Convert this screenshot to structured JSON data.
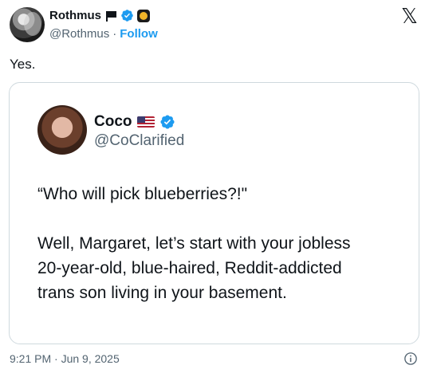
{
  "author": {
    "display_name": "Rothmus",
    "handle": "@Rothmus",
    "separator": "·",
    "follow_label": "Follow",
    "icons": [
      "flag-icon",
      "verified-icon",
      "badge-icon"
    ]
  },
  "brand": {
    "logo_text": "𝕏",
    "logo_name": "x-logo"
  },
  "tweet": {
    "text": "Yes."
  },
  "quoted": {
    "display_name": "Coco",
    "handle": "@CoClarified",
    "icons": [
      "us-flag-icon",
      "verified-icon"
    ],
    "lines": [
      "“Who will pick blueberries?!\"",
      "Well, Margaret, let’s start with your jobless",
      "20-year-old, blue-haired, Reddit-addicted",
      "trans son living in your basement."
    ]
  },
  "footer": {
    "timestamp": "9:21 PM · Jun 9, 2025",
    "info_icon": "info-icon"
  },
  "colors": {
    "accent": "#1d9bf0",
    "text": "#0f1419",
    "muted": "#536471",
    "border": "#cfd9de"
  }
}
